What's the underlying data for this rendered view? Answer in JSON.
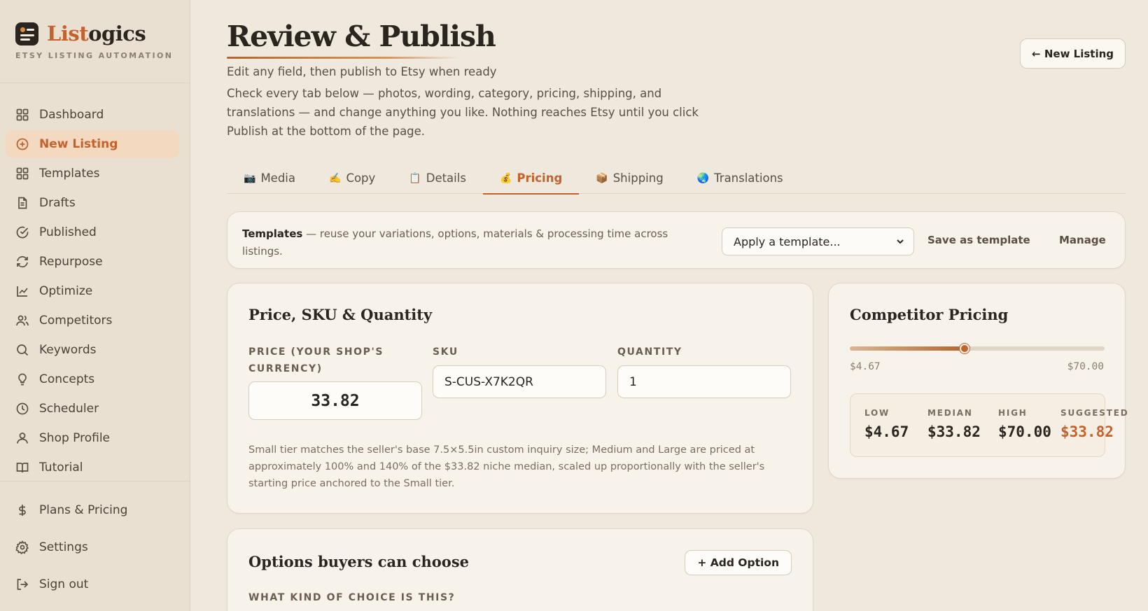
{
  "brand": {
    "name_part1": "List",
    "name_part2": "ogics",
    "tagline": "ETSY LISTING AUTOMATION"
  },
  "sidebar": {
    "items": [
      {
        "label": "Dashboard",
        "icon": "grid-icon"
      },
      {
        "label": "New Listing",
        "icon": "plus-circle-icon",
        "active": true
      },
      {
        "label": "Templates",
        "icon": "grid-icon"
      },
      {
        "label": "Drafts",
        "icon": "document-icon"
      },
      {
        "label": "Published",
        "icon": "check-circle-icon"
      },
      {
        "label": "Repurpose",
        "icon": "refresh-icon"
      },
      {
        "label": "Optimize",
        "icon": "line-chart-icon"
      },
      {
        "label": "Competitors",
        "icon": "users-icon"
      },
      {
        "label": "Keywords",
        "icon": "search-icon"
      },
      {
        "label": "Concepts",
        "icon": "lightbulb-icon"
      },
      {
        "label": "Scheduler",
        "icon": "clock-icon"
      },
      {
        "label": "Shop Profile",
        "icon": "user-icon"
      },
      {
        "label": "Tutorial",
        "icon": "book-icon"
      }
    ],
    "bottom": [
      {
        "label": "Plans & Pricing",
        "icon": "dollar-icon"
      },
      {
        "label": "Settings",
        "icon": "gear-icon"
      },
      {
        "label": "Sign out",
        "icon": "sign-out-icon"
      }
    ]
  },
  "header": {
    "title": "Review & Publish",
    "subtitle": "Edit any field, then publish to Etsy when ready",
    "description": "Check every tab below — photos, wording, category, pricing, shipping, and translations — and change anything you like. Nothing reaches Etsy until you click Publish at the bottom of the page.",
    "new_listing_button": "← New Listing"
  },
  "tabs": [
    {
      "label": "Media",
      "icon": "📷"
    },
    {
      "label": "Copy",
      "icon": "✍️"
    },
    {
      "label": "Details",
      "icon": "📋"
    },
    {
      "label": "Pricing",
      "icon": "💰",
      "active": true
    },
    {
      "label": "Shipping",
      "icon": "📦"
    },
    {
      "label": "Translations",
      "icon": "🌏"
    }
  ],
  "templates_bar": {
    "title": "Templates",
    "text": " — reuse your variations, options, materials & processing time across listings.",
    "select_placeholder": "Apply a template...",
    "save_label": "Save as template",
    "manage_label": "Manage"
  },
  "price_card": {
    "title": "Price, SKU & Quantity",
    "price_label": "PRICE (YOUR SHOP'S CURRENCY)",
    "price_value": "33.82",
    "sku_label": "SKU",
    "sku_value": "S-CUS-X7K2QR",
    "quantity_label": "QUANTITY",
    "quantity_value": "1",
    "note": "Small tier matches the seller's base 7.5×5.5in custom inquiry size; Medium and Large are priced at approximately 100% and 140% of the $33.82 niche median, scaled up proportionally with the seller's starting price anchored to the Small tier."
  },
  "competitor_card": {
    "title": "Competitor Pricing",
    "range_min": "$4.67",
    "range_max": "$70.00",
    "slider_position": 0.45,
    "low_label": "LOW",
    "low_value": "$4.67",
    "median_label": "MEDIAN",
    "median_value": "$33.82",
    "high_label": "HIGH",
    "high_value": "$70.00",
    "suggested_label": "SUGGESTED",
    "suggested_value": "$33.82"
  },
  "options_card": {
    "title": "Options buyers can choose",
    "add_button": "+ Add Option",
    "field_label": "WHAT KIND OF CHOICE IS THIS?"
  },
  "colors": {
    "accent": "#c4622d",
    "background": "#efe8dc",
    "sidebar": "#e9e0d1",
    "card": "#f8f3ea"
  }
}
